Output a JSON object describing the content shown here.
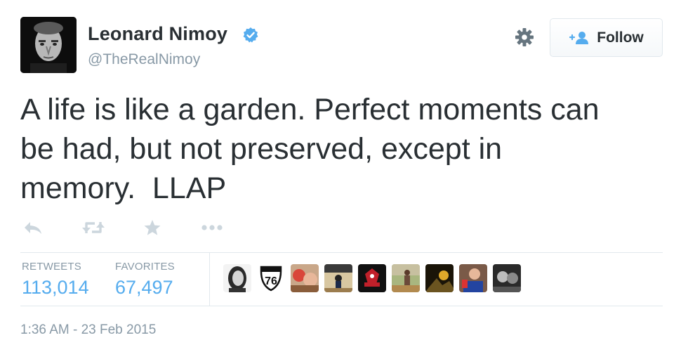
{
  "user": {
    "name": "Leonard Nimoy",
    "handle": "@TheRealNimoy",
    "verified": true
  },
  "header": {
    "follow_label": "Follow",
    "settings_icon": "gear-icon",
    "follow_icon": "follow-person-icon"
  },
  "tweet": {
    "text": "A life is like a garden. Perfect moments can\nbe had, but not preserved, except in\nmemory.  LLAP",
    "timestamp": "1:36 AM - 23 Feb 2015"
  },
  "actions": [
    "reply-icon",
    "retweet-icon",
    "favorite-icon",
    "more-icon"
  ],
  "stats": {
    "retweets_label": "RETWEETS",
    "retweets_value": "113,014",
    "favorites_label": "FAVORITES",
    "favorites_value": "67,497"
  },
  "favoriters": [
    {
      "id": "favoriter-avatar-1",
      "badge": ""
    },
    {
      "id": "favoriter-avatar-2",
      "badge": "76"
    },
    {
      "id": "favoriter-avatar-3",
      "badge": ""
    },
    {
      "id": "favoriter-avatar-4",
      "badge": ""
    },
    {
      "id": "favoriter-avatar-5",
      "badge": ""
    },
    {
      "id": "favoriter-avatar-6",
      "badge": ""
    },
    {
      "id": "favoriter-avatar-7",
      "badge": ""
    },
    {
      "id": "favoriter-avatar-8",
      "badge": ""
    },
    {
      "id": "favoriter-avatar-9",
      "badge": ""
    }
  ],
  "colors": {
    "link_blue": "#55acee",
    "muted_gray": "#8899a6",
    "text_dark": "#292f33",
    "action_gray": "#ccd6dd",
    "verified_blue": "#55acee"
  }
}
